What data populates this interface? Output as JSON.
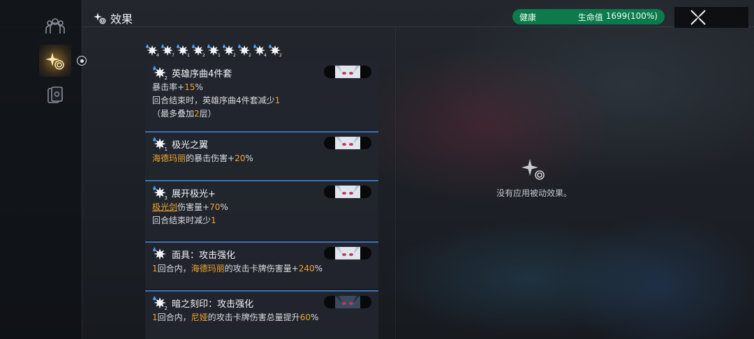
{
  "header": {
    "title": "效果",
    "icon": "sparkle-swirl-icon"
  },
  "health": {
    "status": "健康",
    "hp_label": "生命值",
    "hp_value": "1699(100%)",
    "color": "#0d7a4c"
  },
  "close": {
    "icon": "close-x-icon"
  },
  "rail": {
    "items": [
      {
        "icon": "party-members-icon",
        "active": false
      },
      {
        "icon": "sparkle-swirl-icon",
        "active": true
      },
      {
        "icon": "card-deck-icon",
        "active": false
      }
    ]
  },
  "effect_icon_counts": [
    "4",
    "7",
    "1",
    "2",
    "1",
    "20",
    "2",
    "4",
    "2"
  ],
  "accent": "#f0a630",
  "cards": [
    {
      "title": "英雄序曲4件套",
      "icon_count": "2",
      "lines": [
        [
          {
            "t": "暴击率+"
          },
          {
            "t": "15",
            "hl": true
          },
          {
            "t": "%"
          }
        ],
        [
          {
            "t": "回合结束时，英雄序曲4件套减少"
          },
          {
            "t": "1",
            "hl": true
          }
        ],
        [
          {
            "t": "（最多叠加"
          },
          {
            "t": "2",
            "hl": true
          },
          {
            "t": "层）"
          }
        ]
      ]
    },
    {
      "title": "极光之翼",
      "icon_count": "1",
      "lines": [
        [
          {
            "t": "海德玛丽",
            "hl": true
          },
          {
            "t": "的暴击伤害+"
          },
          {
            "t": "20",
            "hl": true
          },
          {
            "t": "%"
          }
        ]
      ]
    },
    {
      "title": "展开极光+",
      "icon_count": "3",
      "lines": [
        [
          {
            "t": "极光剑",
            "hlu": true
          },
          {
            "t": "伤害量+"
          },
          {
            "t": "70",
            "hl": true
          },
          {
            "t": "%"
          }
        ],
        [
          {
            "t": "回合结束时减少"
          },
          {
            "t": "1",
            "hl": true
          }
        ]
      ]
    },
    {
      "title": "面具：攻击强化",
      "icon_count": "",
      "lines": [
        [
          {
            "t": "1",
            "hl": true
          },
          {
            "t": "回合内，"
          },
          {
            "t": "海德玛丽",
            "hl": true
          },
          {
            "t": "的攻击卡牌伤害量+"
          },
          {
            "t": "240",
            "hl": true
          },
          {
            "t": "%"
          }
        ]
      ]
    },
    {
      "title": "暗之刻印：攻击强化",
      "icon_count": "2",
      "lines": [
        [
          {
            "t": "1",
            "hl": true
          },
          {
            "t": "回合内，"
          },
          {
            "t": "尼娅",
            "hl": true
          },
          {
            "t": "的攻击卡牌伤害总量提升"
          },
          {
            "t": "60",
            "hl": true
          },
          {
            "t": "%"
          }
        ]
      ]
    }
  ],
  "passive": {
    "message": "没有应用被动效果。",
    "icon": "sparkle-swirl-icon"
  }
}
